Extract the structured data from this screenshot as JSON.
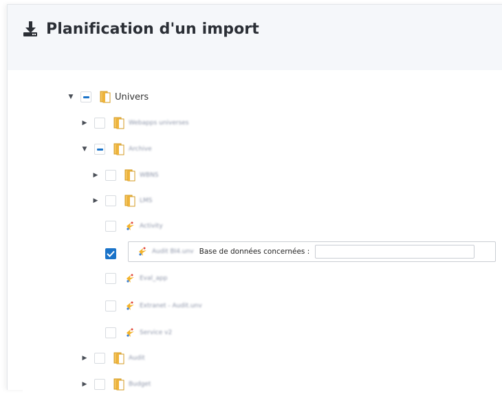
{
  "page": {
    "title": "Planification d'un import",
    "title_icon": "download-icon"
  },
  "tree": {
    "root": {
      "label": "Univers",
      "state": "partial",
      "expanded": true,
      "icon": "universe-folder-icon"
    },
    "children": [
      {
        "label": "Webapps universes",
        "state": "unchecked",
        "expanded": false,
        "icon": "universe-folder-icon",
        "blurred": true
      },
      {
        "label": "Archive",
        "state": "partial",
        "expanded": true,
        "icon": "universe-folder-icon",
        "blurred": true,
        "children": [
          {
            "label": "WBNS",
            "state": "unchecked",
            "expanded": false,
            "icon": "universe-folder-icon",
            "blurred": true
          },
          {
            "label": "LMS",
            "state": "unchecked",
            "expanded": false,
            "icon": "universe-folder-icon",
            "blurred": true
          },
          {
            "label": "Activity",
            "state": "unchecked",
            "icon": "universe-item-icon",
            "blurred": true
          },
          {
            "label": "Audit BI4.unv",
            "state": "checked",
            "icon": "universe-item-icon",
            "blurred": true,
            "db_label": "Base de données concernées :",
            "db_value": ""
          },
          {
            "label": "Eval_app",
            "state": "unchecked",
            "icon": "universe-item-icon",
            "blurred": true
          },
          {
            "label": "Extranet - Audit.unv",
            "state": "unchecked",
            "icon": "universe-item-icon",
            "blurred": true
          },
          {
            "label": "Service v2",
            "state": "unchecked",
            "icon": "universe-item-icon",
            "blurred": true
          }
        ]
      },
      {
        "label": "Audit",
        "state": "unchecked",
        "expanded": false,
        "icon": "universe-folder-icon",
        "blurred": true
      },
      {
        "label": "Budget",
        "state": "unchecked",
        "expanded": false,
        "icon": "universe-folder-icon",
        "blurred": true
      }
    ]
  },
  "colors": {
    "accent": "#1a73c9",
    "header_bg": "#f5f7fa",
    "folder": "#e8a51a"
  }
}
